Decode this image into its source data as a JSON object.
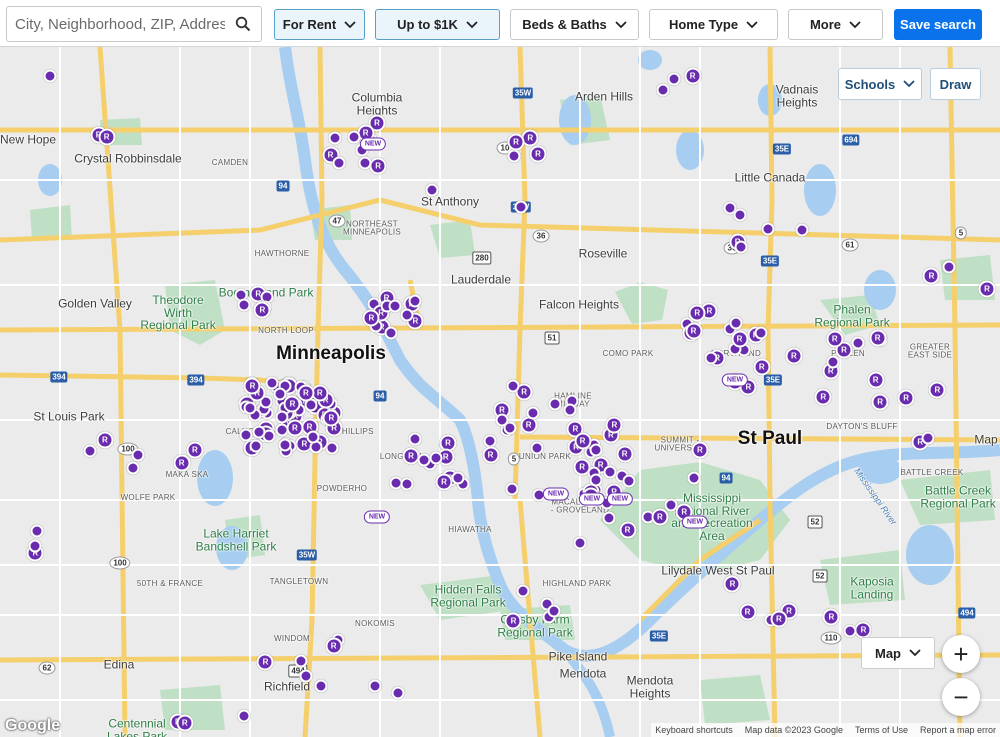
{
  "search": {
    "placeholder": "City, Neighborhood, ZIP, Address"
  },
  "filters": {
    "listing_type": "For Rent",
    "price": "Up to $1K",
    "beds_baths": "Beds & Baths",
    "home_type": "Home Type",
    "more": "More",
    "save_search": "Save search"
  },
  "map_controls": {
    "schools": "Schools",
    "draw": "Draw",
    "map_type": "Map",
    "zoom_in": "+",
    "zoom_out": "−"
  },
  "attribution": {
    "logo": "Google",
    "shortcuts": "Keyboard shortcuts",
    "map_data": "Map data ©2023 Google",
    "terms": "Terms of Use",
    "report": "Report a map error"
  },
  "places": {
    "minneapolis": "Minneapolis",
    "st_paul": "St Paul",
    "new_hope": "New Hope",
    "crystal": "Crystal Robbinsdale",
    "camden": "CAMDEN",
    "columbia_heights": "Columbia\nHeights",
    "arden_hills": "Arden Hills",
    "vadnais": "Vadnais\nHeights",
    "little_canada": "Little Canada",
    "st_anthony": "St Anthony",
    "hawthorne": "HAWTHORNE",
    "ne_minneapolis": "NORTHEAST\nMINNEAPOLIS",
    "roseville": "Roseville",
    "lauderdale": "Lauderdale",
    "falcon_heights": "Falcon Heights",
    "golden_valley": "Golden Valley",
    "theodore_wirth": "Theodore\nWirth\nRegional Park",
    "boom_island": "Boom Island Park",
    "north_loop": "NORTH LOOP",
    "phalen_park": "Phalen\nRegional Park",
    "como_park": "COMO PARK",
    "north_end": "NORTH END",
    "phalen": "PHALEN",
    "greater_east_side": "GREATER\nEAST SIDE",
    "st_louis_park": "St Louis Park",
    "hamline": "HAMLINE\nMIDWAY",
    "summit_university": "SUMMIT -\nUNIVERSITY",
    "daytons_bluff": "DAYTON'S BLUFF",
    "calhoun": "CALHO",
    "phillips": "PHILLIPS",
    "longfellow": "LONGFELL",
    "union_park": "UNION PARK",
    "battle_creek": "BATTLE CREEK",
    "battle_creek_park": "Battle Creek\nRegional Park",
    "maka_ska": "MAKA SKA",
    "wolfe_park": "WOLFE PARK",
    "powderhorn": "POWDERHO",
    "macalester": "MACALESTER\n- GROVELAND",
    "mississippi_river": "Mississippi\nNational River\nand Recreation\nArea",
    "lake_harriet": "Lake Harriet\nBandshell Park",
    "hiawatha": "HIAWATHA",
    "lilydale": "Lilydale  West St Paul",
    "south_france": "50TH & FRANCE",
    "tangletown": "TANGLETOWN",
    "highland_park": "HIGHLAND PARK",
    "hidden_falls": "Hidden Falls\nRegional Park",
    "kaposia": "Kaposia\nLanding",
    "nokomis": "NOKOMIS",
    "crosby_farm": "Crosby Farm\nRegional Park",
    "pike_island": "Pike Island",
    "edina": "Edina",
    "mendota": "Mendota",
    "mendota_heights": "Mendota\nHeights",
    "windom": "WINDOM",
    "richfield": "Richfield",
    "centennial": "Centennial\nLakes Park",
    "map_edge": "Map",
    "mississippi_label": "Mississippi River"
  }
}
